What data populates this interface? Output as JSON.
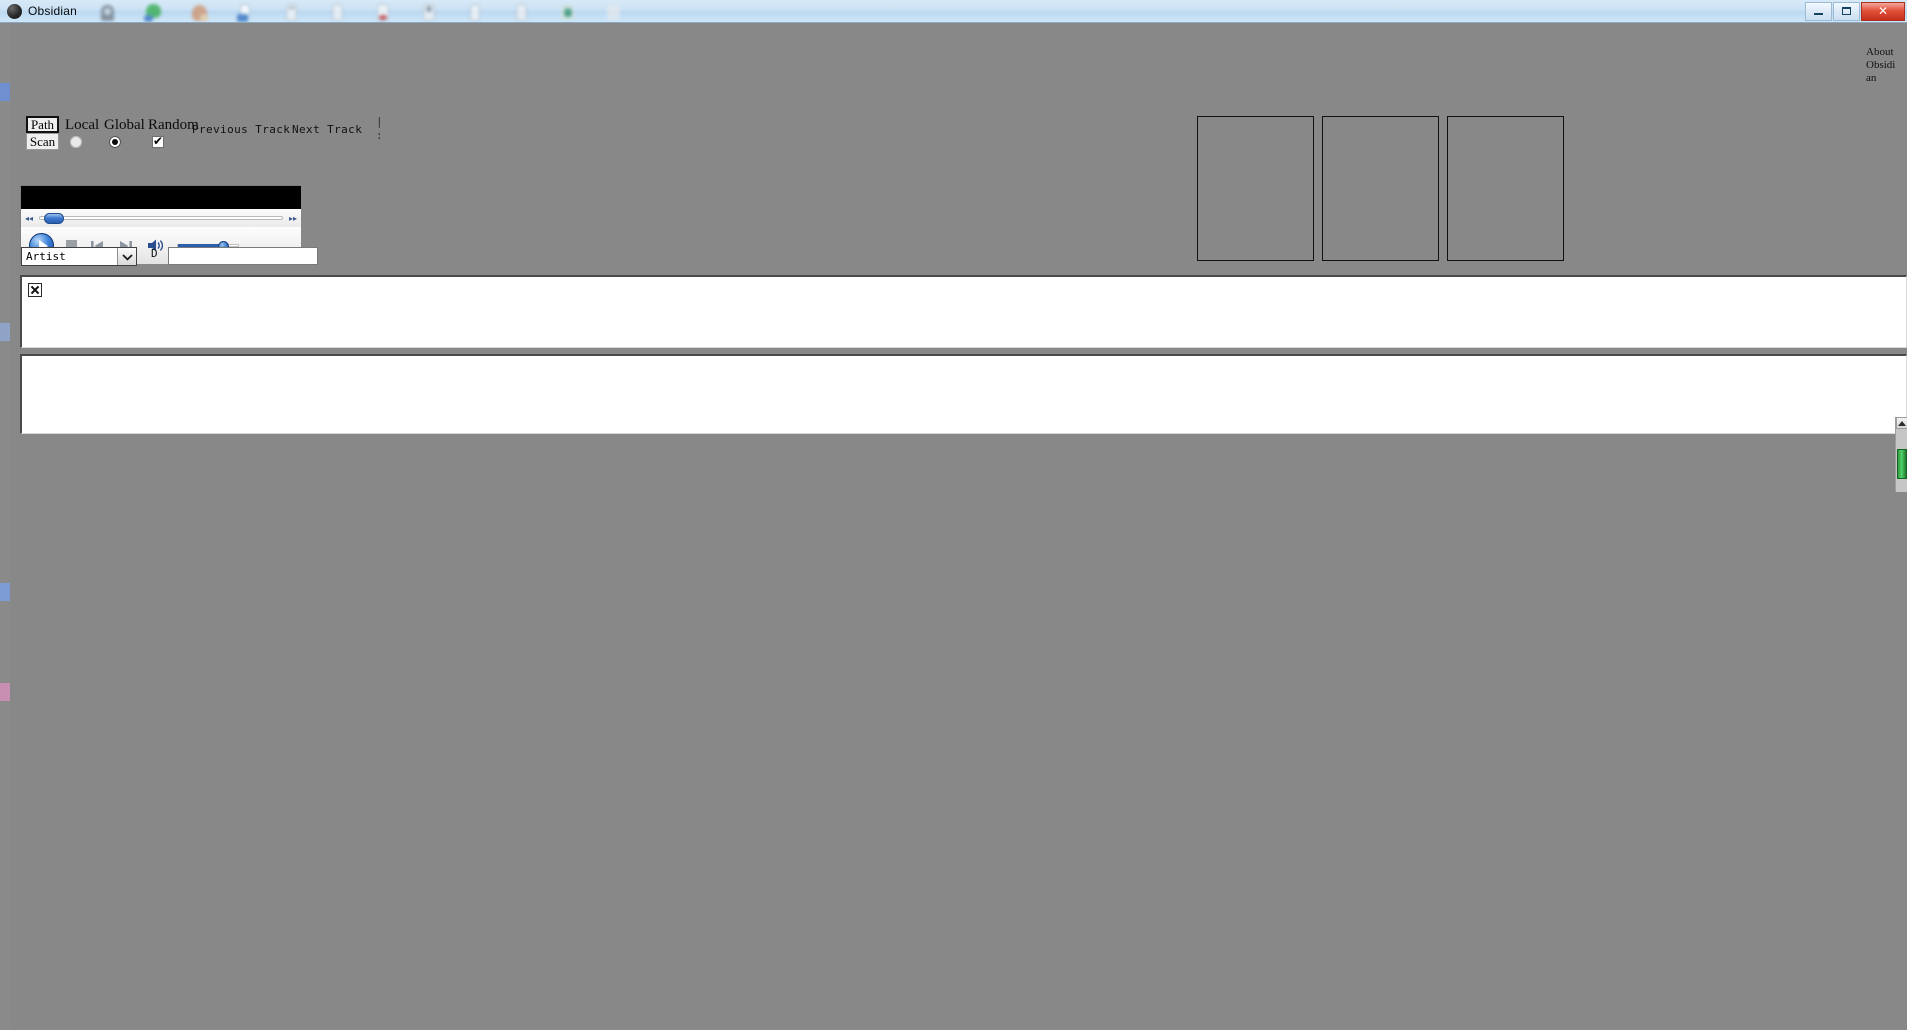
{
  "window": {
    "title": "Obsidian",
    "icon": "obsidian-orb-icon",
    "controls": {
      "minimize": "–",
      "maximize": "□",
      "close": "✕"
    }
  },
  "about": {
    "label": "About Obsidian"
  },
  "controls": {
    "path_button": "Path",
    "scan_button": "Scan",
    "mode_labels": {
      "local": "Local",
      "global": "Global",
      "random": "Random"
    },
    "mode_selected": "Global",
    "random_checked": true,
    "local_checked": false,
    "previous_track": "Previous Track",
    "next_track": "Next Track",
    "status_mark": "|\n:"
  },
  "player": {
    "play_state": "playing",
    "seek_position_percent": 8,
    "volume_percent": 66,
    "buttons": {
      "play": "play-button",
      "stop": "stop-button",
      "previous": "previous-button",
      "next": "next-button",
      "volume": "volume-button"
    },
    "rewind_glyph": "◂◂",
    "forward_glyph": "▸▸"
  },
  "filter": {
    "field_selected": "Artist",
    "field_options": [
      "Artist"
    ],
    "dropdown_glyph": "⌄",
    "d_label": "D",
    "search_value": "",
    "search_placeholder": ""
  },
  "panes": {
    "top": {
      "name": "results-pane",
      "broken_image": true,
      "items": []
    },
    "bottom": {
      "name": "playlist-pane",
      "items": []
    }
  },
  "right_boxes": [
    {
      "name": "album-art-slot-1",
      "label": ""
    },
    {
      "name": "album-art-slot-2",
      "label": ""
    },
    {
      "name": "album-art-slot-3",
      "label": ""
    }
  ],
  "scrollbar": {
    "up_glyph": "▲",
    "thumb_color": "#3fb254",
    "position_percent": 55
  },
  "colors": {
    "app_background": "#888888",
    "titlebar": "#cde3f5",
    "close_button": "#d4452e",
    "accent_blue": "#2a5fae",
    "scroll_green": "#3fb254"
  },
  "taskbar_icons": [
    "icon-1",
    "icon-2",
    "icon-3",
    "icon-4",
    "icon-5",
    "icon-6",
    "icon-7",
    "icon-8",
    "icon-9",
    "icon-10",
    "icon-11",
    "icon-12"
  ]
}
